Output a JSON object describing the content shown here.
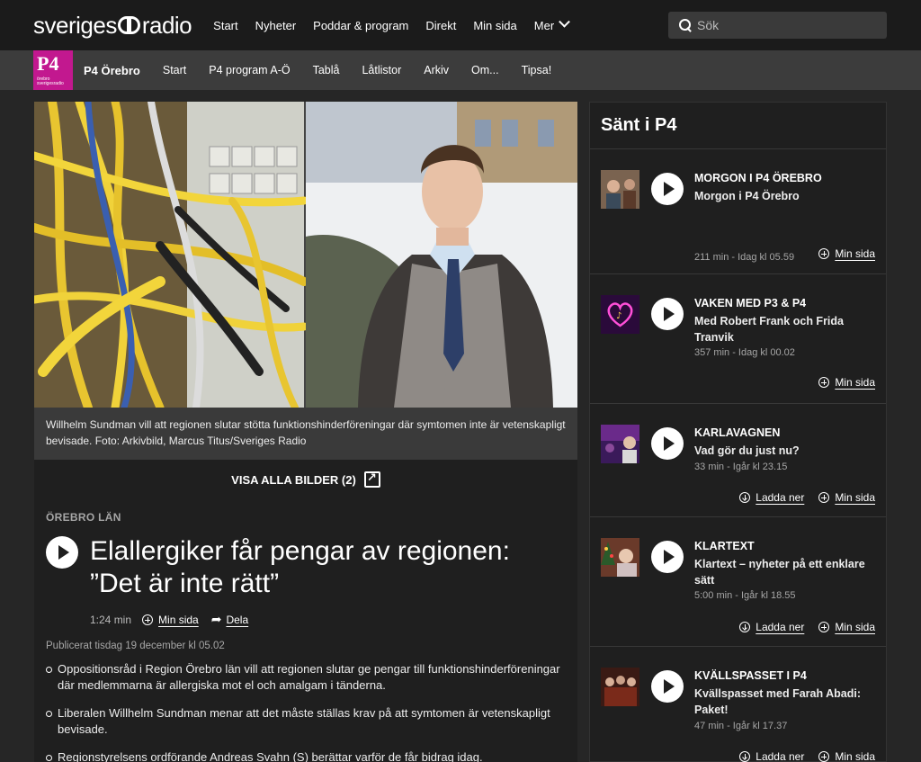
{
  "header": {
    "logo_text_a": "sveriges",
    "logo_text_b": "radio",
    "nav": [
      "Start",
      "Nyheter",
      "Poddar & program",
      "Direkt",
      "Min sida",
      "Mer"
    ],
    "search_placeholder": "Sök"
  },
  "subnav": {
    "logo_big": "P4",
    "logo_small": "örebro sverigesradio",
    "channel": "P4 Örebro",
    "items": [
      "Start",
      "P4 program A-Ö",
      "Tablå",
      "Låtlistor",
      "Arkiv",
      "Om...",
      "Tipsa!"
    ]
  },
  "article": {
    "caption": "Willhelm Sundman vill att regionen slutar stötta funktionshinderföreningar där symtomen inte är vetenskapligt bevisade. Foto: Arkivbild, Marcus Titus/Sveriges Radio",
    "show_all_label": "VISA ALLA BILDER (2)",
    "kicker": "ÖREBRO LÄN",
    "headline": "Elallergiker får pengar av regionen: ”Det är inte rätt”",
    "duration": "1:24 min",
    "my_page": "Min sida",
    "share": "Dela",
    "published": "Publicerat tisdag 19 december kl 05.02",
    "bullets": [
      "Oppositionsråd i Region Örebro län vill att regionen slutar ge pengar till funktionshinderföreningar där medlemmarna är allergiska mot el och amalgam i tänderna.",
      "Liberalen Willhelm Sundman menar att det måste ställas krav på att symtomen är vetenskapligt bevisade.",
      "Regionstyrelsens ordförande Andreas Svahn (S) berättar varför de får bidrag idag."
    ]
  },
  "sidebar": {
    "title": "Sänt i P4",
    "download_label": "Ladda ner",
    "my_page_label": "Min sida",
    "items": [
      {
        "show": "MORGON I P4 ÖREBRO",
        "episode": "Morgon i P4 Örebro",
        "meta": "211 min  -  Idag kl 05.59"
      },
      {
        "show": "VAKEN MED P3 & P4",
        "episode": "Med Robert Frank och Frida Tranvik",
        "meta": "357 min  -  Idag kl 00.02"
      },
      {
        "show": "KARLAVAGNEN",
        "episode": "Vad gör du just nu?",
        "meta": "33 min  -  Igår kl 23.15"
      },
      {
        "show": "KLARTEXT",
        "episode": "Klartext – nyheter på ett enklare sätt",
        "meta": "5:00 min  -  Igår kl 18.55"
      },
      {
        "show": "KVÄLLSPASSET I P4",
        "episode": "Kvällspasset med Farah Abadi: Paket!",
        "meta": "47 min  -  Igår kl 17.37"
      }
    ]
  },
  "colors": {
    "p4_brand": "#c2188f",
    "page_bg": "#262626",
    "panel_bg": "#1f1f1f"
  }
}
